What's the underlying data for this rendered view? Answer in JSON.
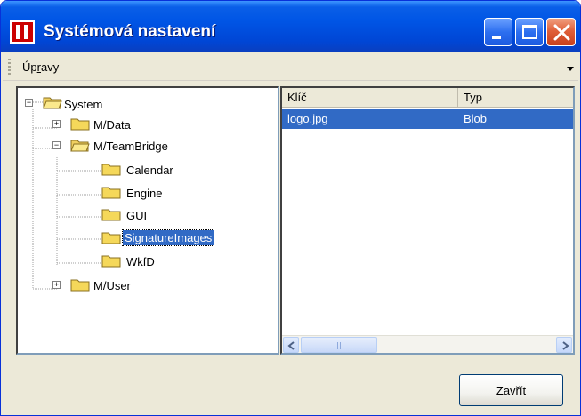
{
  "window": {
    "title": "Systémová nastavení"
  },
  "menu": {
    "items": [
      {
        "label": "Úpravy",
        "mnemonic": "r"
      }
    ]
  },
  "tree": {
    "nodes": [
      {
        "label": "System",
        "depth": 0,
        "expanded": true,
        "has_children": true
      },
      {
        "label": "M/Data",
        "depth": 1,
        "expanded": false,
        "has_children": true
      },
      {
        "label": "M/TeamBridge",
        "depth": 1,
        "expanded": true,
        "has_children": true
      },
      {
        "label": "Calendar",
        "depth": 2,
        "expanded": false,
        "has_children": false
      },
      {
        "label": "Engine",
        "depth": 2,
        "expanded": false,
        "has_children": false
      },
      {
        "label": "GUI",
        "depth": 2,
        "expanded": false,
        "has_children": false
      },
      {
        "label": "SignatureImages",
        "depth": 2,
        "expanded": false,
        "has_children": false,
        "selected": true
      },
      {
        "label": "WkfD",
        "depth": 2,
        "expanded": false,
        "has_children": false
      },
      {
        "label": "M/User",
        "depth": 1,
        "expanded": false,
        "has_children": true
      }
    ]
  },
  "list": {
    "columns": [
      "Klíč",
      "Typ"
    ],
    "rows": [
      {
        "key": "logo.jpg",
        "type": "Blob",
        "selected": true
      }
    ]
  },
  "buttons": {
    "close_label": "Zavřít"
  },
  "colors": {
    "selection": "#316ac5",
    "titlebar": "#0055e5",
    "window_bg": "#ece9d8"
  }
}
